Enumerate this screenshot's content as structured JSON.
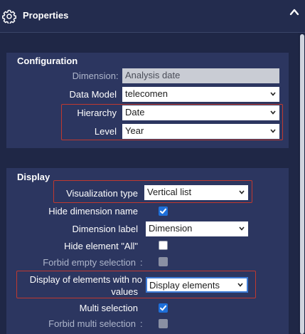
{
  "header": {
    "title": "Properties"
  },
  "configuration": {
    "title": "Configuration",
    "dimension_label": "Dimension",
    "dimension_value": "Analysis date",
    "data_model_label": "Data Model",
    "data_model_value": "telecomen",
    "hierarchy_label": "Hierarchy",
    "hierarchy_value": "Date",
    "level_label": "Level",
    "level_value": "Year"
  },
  "display": {
    "title": "Display",
    "visualization_type_label": "Visualization type",
    "visualization_type_value": "Vertical list",
    "hide_dimension_name_label": "Hide dimension name",
    "hide_dimension_name_checked": true,
    "dimension_label_label": "Dimension label",
    "dimension_label_value": "Dimension",
    "hide_element_all_label": "Hide element \"All\"",
    "hide_element_all_checked": false,
    "forbid_empty_selection_label": "Forbid empty selection",
    "display_elements_no_values_label_1": "Display of elements with no",
    "display_elements_no_values_label_2": "values",
    "display_elements_no_values_value": "Display elements",
    "multi_selection_label": "Multi selection",
    "multi_selection_checked": true,
    "forbid_multi_selection_label": "Forbid multi selection"
  },
  "colors": {
    "background": "#1f2746",
    "panel": "#2c3660",
    "accent": "#1e6fd9",
    "highlight": "#c0392f"
  },
  "icons": [
    "gear-icon",
    "chevron-up-icon",
    "chevron-down-icon"
  ]
}
